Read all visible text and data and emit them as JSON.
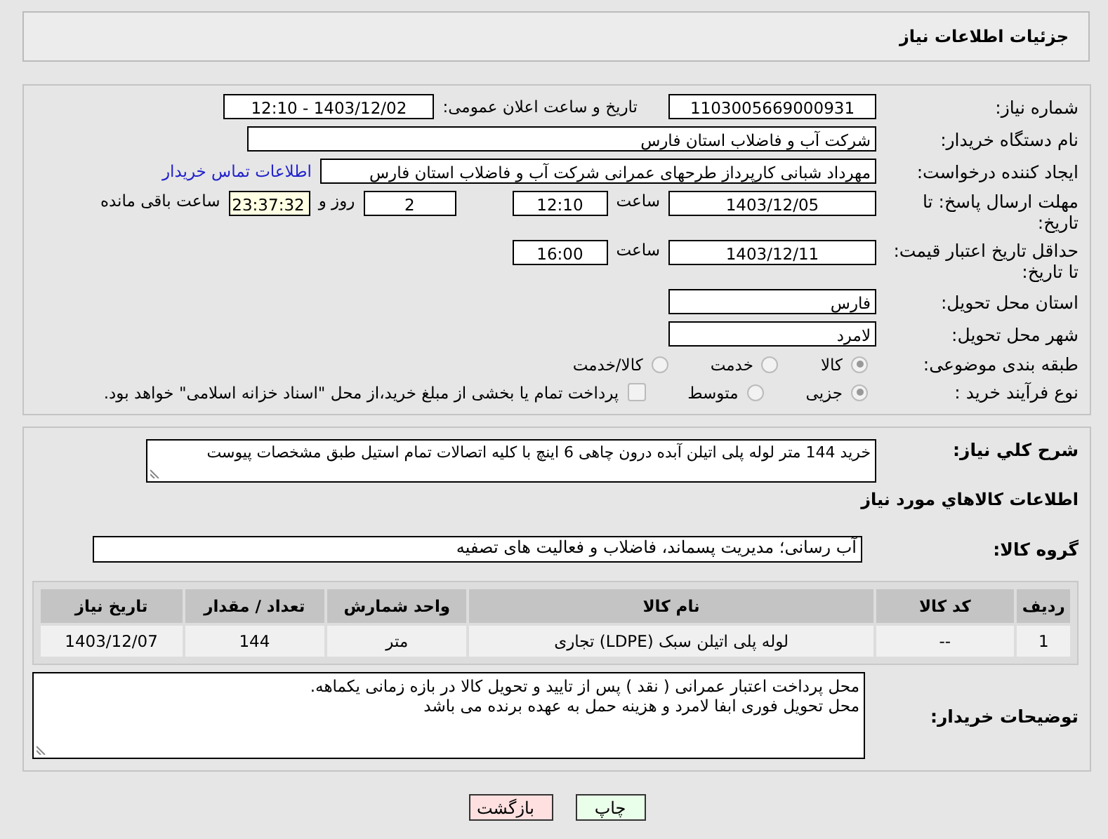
{
  "header": {
    "title": "جزئیات اطلاعات نیاز"
  },
  "need_number": {
    "label": "شماره نیاز:",
    "value": "1103005669000931"
  },
  "announce": {
    "label": "تاریخ و ساعت اعلان عمومی:",
    "value": "1403/12/02 - 12:10"
  },
  "buyer_org": {
    "label": "نام دستگاه خریدار:",
    "value": "شرکت آب و فاضلاب استان فارس"
  },
  "requester": {
    "label": "ایجاد کننده درخواست:",
    "value": "مهرداد شبانی کارپرداز طرحهای عمرانی  شرکت آب و فاضلاب استان فارس",
    "link": "اطلاعات تماس خریدار"
  },
  "reply_deadline": {
    "label": "مهلت ارسال پاسخ: تا تاریخ:",
    "date": "1403/12/05",
    "time_label": "ساعت",
    "time": "12:10",
    "days": "2",
    "days_label": "روز و",
    "remaining": "23:37:32",
    "remaining_label": "ساعت باقی مانده"
  },
  "price_validity": {
    "label": "حداقل تاریخ اعتبار قیمت: تا تاریخ:",
    "date": "1403/12/11",
    "time_label": "ساعت",
    "time": "16:00"
  },
  "province": {
    "label": "استان محل تحویل:",
    "value": "فارس"
  },
  "city": {
    "label": "شهر محل تحویل:",
    "value": "لامرد"
  },
  "category": {
    "label": "طبقه بندی موضوعی:",
    "options": [
      {
        "label": "کالا",
        "selected": true
      },
      {
        "label": "خدمت",
        "selected": false
      },
      {
        "label": "کالا/خدمت",
        "selected": false
      }
    ]
  },
  "process": {
    "label": "نوع فرآیند خرید :",
    "options": [
      {
        "kind": "radio",
        "label": "جزیی",
        "selected": true
      },
      {
        "kind": "radio",
        "label": "متوسط",
        "selected": false
      },
      {
        "kind": "checkbox",
        "label": "پرداخت تمام یا بخشی از مبلغ خرید،از محل \"اسناد خزانه اسلامی\" خواهد بود.",
        "checked": false
      }
    ]
  },
  "description": {
    "label": "شرح کلي نیاز:",
    "value": "خرید 144 متر لوله پلی اتیلن آبده درون چاهی 6 اینچ  با کلیه اتصالات تمام استیل  طبق مشخصات پیوست"
  },
  "items_heading": "اطلاعات کالاهاي مورد نیاز",
  "goods_group": {
    "label": "گروه کالا:",
    "value": "آب رسانی؛ مدیریت پسماند، فاضلاب و فعالیت های تصفیه"
  },
  "table": {
    "columns": [
      "ردیف",
      "کد کالا",
      "نام کالا",
      "واحد شمارش",
      "تعداد / مقدار",
      "تاریخ نیاز"
    ],
    "rows": [
      [
        "1",
        "--",
        "لوله پلی اتیلن سبک (LDPE) تجاری",
        "متر",
        "144",
        "1403/12/07"
      ]
    ]
  },
  "buyer_notes": {
    "label": "توضیحات خریدار:",
    "lines": [
      "محل پرداخت اعتبار عمرانی ( نقد ) پس از تایید و تحویل کالا در بازه زمانی یکماهه.",
      "محل تحویل فوری ابفا لامرد و هزینه حمل به عهده برنده می باشد"
    ]
  },
  "buttons": [
    {
      "kind": "print",
      "label": "چاپ"
    },
    {
      "kind": "back",
      "label": "بازگشت"
    }
  ]
}
